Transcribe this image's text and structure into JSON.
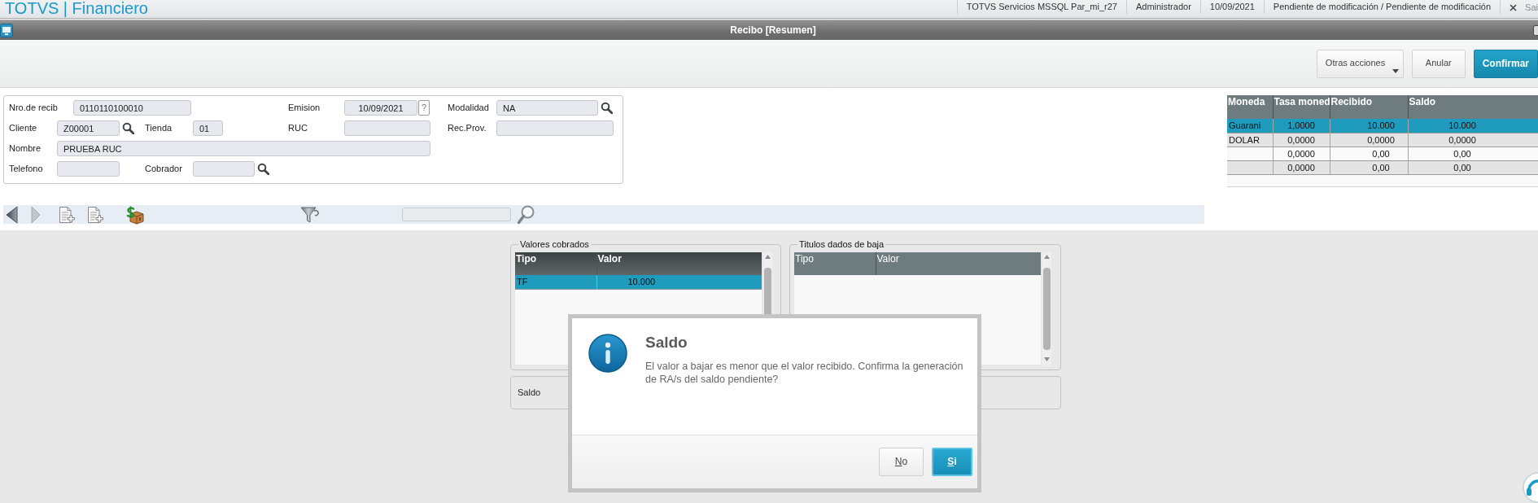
{
  "header": {
    "brand": "TOTVS | Financiero",
    "info": [
      "TOTVS Servicios MSSQL Par_mi_r27",
      "Administrador",
      "10/09/2021",
      "Pendiente de modificación / Pendiente de modificación"
    ],
    "exit": "Sai"
  },
  "window": {
    "title": "Recibo [Resumen]"
  },
  "actions": [
    {
      "label": "Otras acciones",
      "kind": "menu"
    },
    {
      "label": "Anular",
      "kind": "default"
    },
    {
      "label": "Confirmar",
      "kind": "primary"
    }
  ],
  "form": {
    "rows": [
      [
        {
          "label": "Nro.de recib",
          "value": "0110110100010",
          "kind": "text"
        },
        null,
        {
          "label": "Emision",
          "value": "10/09/2021",
          "kind": "date",
          "help": "?"
        },
        {
          "label": "Modalidad",
          "value": "NA",
          "kind": "lookup"
        }
      ],
      [
        {
          "label": "Cliente",
          "value": "Z00001",
          "kind": "lookup"
        },
        {
          "label": "Tienda",
          "value": "01",
          "kind": "text"
        },
        {
          "label": "RUC",
          "kind": "text"
        },
        {
          "label": "Rec.Prov.",
          "kind": "text"
        }
      ],
      [
        {
          "label": "Nombre",
          "value": "PRUEBA RUC",
          "kind": "text"
        }
      ],
      [
        {
          "label": "Telefono",
          "kind": "text"
        },
        {
          "label": "Cobrador",
          "kind": "lookup"
        }
      ]
    ]
  },
  "currency_table": {
    "columns": [
      "Moneda",
      "Tasa moned",
      "Recibido",
      "Saldo"
    ],
    "rows": [
      {
        "cells": [
          "Guarani",
          "1,0000",
          "10.000",
          "10.000"
        ],
        "selected": true
      },
      {
        "cells": [
          "DOLAR",
          "0,0000",
          "0,0000",
          "0,0000"
        ],
        "selected": false
      },
      {
        "cells": [
          null,
          "0,0000",
          "0,00",
          "0,00"
        ],
        "selected": false
      },
      {
        "cells": [
          null,
          "0,0000",
          "0,00",
          "0,00"
        ],
        "selected": false
      }
    ]
  },
  "panels": [
    {
      "legend": "Valores cobrados",
      "focused": true,
      "columns": [
        "Tipo",
        "Valor"
      ],
      "rows": [
        {
          "cells": [
            "TF",
            "10.000"
          ],
          "selected": true
        }
      ]
    },
    {
      "legend": "Titulos dados de baja",
      "focused": false,
      "columns": [
        "Tipo",
        "Valor"
      ]
    }
  ],
  "balance": {
    "label": "Saldo"
  },
  "dialog": {
    "title": "Saldo",
    "message": "El valor a bajar es menor que el valor recibido. Confirma la generación de RA/s del saldo pendiente?",
    "buttons": [
      {
        "label": "No",
        "kind": "default",
        "mnemonic": true
      },
      {
        "label": "Si",
        "kind": "primary",
        "mnemonic": true
      }
    ]
  }
}
